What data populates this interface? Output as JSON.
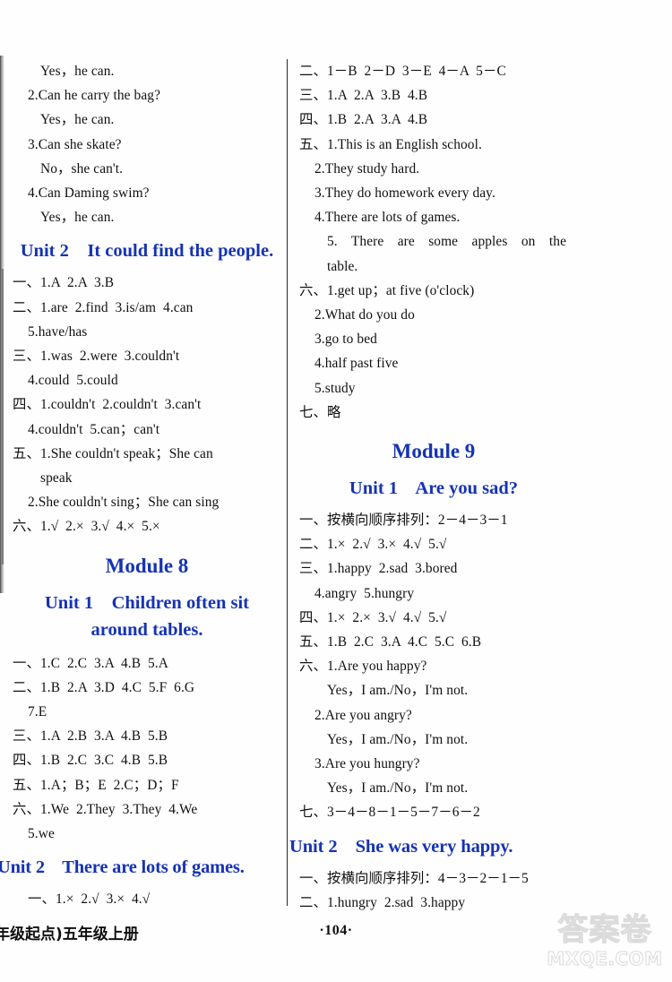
{
  "page": {
    "page_number": "·104·",
    "book_footer": "年级起点)五年级上册",
    "heading_color": "#1633b4"
  },
  "watermark": {
    "chinese": "答案卷",
    "domain": "MXQE.COM"
  },
  "left_column": {
    "blocks": [
      {
        "type": "lines",
        "lines": [
          {
            "indent": 2,
            "text": "Yes，he can."
          },
          {
            "indent": 1,
            "text": "2.Can he carry the bag?"
          },
          {
            "indent": 2,
            "text": "Yes，he can."
          },
          {
            "indent": 1,
            "text": "3.Can she skate?"
          },
          {
            "indent": 2,
            "text": "No，she can't."
          },
          {
            "indent": 1,
            "text": "4.Can Daming swim?"
          },
          {
            "indent": 2,
            "text": "Yes，he can."
          }
        ]
      },
      {
        "type": "unit_heading",
        "unit": "Unit 2",
        "title": "It could find the people.",
        "full": "Unit 2    It could find the people."
      },
      {
        "type": "lines",
        "lines": [
          {
            "indent": 0,
            "text": "一、1.A  2.A  3.B"
          },
          {
            "indent": 0,
            "text": "二、1.are  2.find  3.is/am  4.can"
          },
          {
            "indent": 1,
            "text": "5.have/has"
          },
          {
            "indent": 0,
            "text": "三、1.was  2.were  3.couldn't"
          },
          {
            "indent": 1,
            "text": "4.could  5.could"
          },
          {
            "indent": 0,
            "text": "四、1.couldn't  2.couldn't  3.can't"
          },
          {
            "indent": 1,
            "text": "4.couldn't  5.can；can't"
          },
          {
            "indent": 0,
            "text": "五、1.She couldn't speak；She can"
          },
          {
            "indent": 2,
            "text": "speak"
          },
          {
            "indent": 1,
            "text": "2.She couldn't sing；She can sing"
          },
          {
            "indent": 0,
            "text": "六、1.√  2.×  3.√  4.×  5.×"
          }
        ]
      },
      {
        "type": "module_heading",
        "text": "Module 8"
      },
      {
        "type": "unit_heading_2line",
        "line1": "Unit 1    Children often sit",
        "line2": "around tables."
      },
      {
        "type": "lines",
        "lines": [
          {
            "indent": 0,
            "text": "一、1.C  2.C  3.A  4.B  5.A"
          },
          {
            "indent": 0,
            "text": "二、1.B  2.A  3.D  4.C  5.F  6.G"
          },
          {
            "indent": 1,
            "text": "7.E"
          },
          {
            "indent": 0,
            "text": "三、1.A  2.B  3.A  4.B  5.B"
          },
          {
            "indent": 0,
            "text": "四、1.B  2.C  3.C  4.B  5.B"
          },
          {
            "indent": 0,
            "text": "五、1.A；B；E  2.C；D；F"
          },
          {
            "indent": 0,
            "text": "六、1.We  2.They  3.They  4.We"
          },
          {
            "indent": 1,
            "text": "5.we"
          }
        ]
      },
      {
        "type": "unit_heading_wide",
        "text": "Unit 2    There are lots of games."
      },
      {
        "type": "lines",
        "lines": [
          {
            "indent": 0,
            "text": "一、1.×  2.√  3.×  4.√"
          }
        ]
      }
    ]
  },
  "right_column": {
    "blocks": [
      {
        "type": "lines",
        "lines": [
          {
            "indent": 0,
            "text": "二、1－B  2－D  3－E  4－A  5－C"
          },
          {
            "indent": 0,
            "text": "三、1.A  2.A  3.B  4.B"
          },
          {
            "indent": 0,
            "text": "四、1.B  2.A  3.A  4.B"
          },
          {
            "indent": 0,
            "text": "五、1.This is an English school."
          },
          {
            "indent": 1,
            "text": "2.They study hard."
          },
          {
            "indent": 1,
            "text": "3.They do homework every day."
          },
          {
            "indent": 1,
            "text": "4.There are lots of games."
          }
        ]
      },
      {
        "type": "justified",
        "text": "5. There are some apples on the"
      },
      {
        "type": "lines",
        "lines": [
          {
            "indent": 2,
            "text": "table."
          },
          {
            "indent": 0,
            "text": "六、1.get up；at five (o'clock)"
          },
          {
            "indent": 1,
            "text": "2.What do you do"
          },
          {
            "indent": 1,
            "text": "3.go to bed"
          },
          {
            "indent": 1,
            "text": "4.half past five"
          },
          {
            "indent": 1,
            "text": "5.study"
          },
          {
            "indent": 0,
            "text": "七、略"
          }
        ]
      },
      {
        "type": "module_heading",
        "text": "Module 9"
      },
      {
        "type": "unit_heading",
        "full": "Unit 1    Are you sad?"
      },
      {
        "type": "lines",
        "lines": [
          {
            "indent": 0,
            "text": "一、按横向顺序排列：2－4－3－1"
          },
          {
            "indent": 0,
            "text": "二、1.×  2.√  3.×  4.√  5.√"
          },
          {
            "indent": 0,
            "text": "三、1.happy  2.sad  3.bored"
          },
          {
            "indent": 1,
            "text": "4.angry  5.hungry"
          },
          {
            "indent": 0,
            "text": "四、1.×  2.×  3.√  4.√  5.√"
          },
          {
            "indent": 0,
            "text": "五、1.B  2.C  3.A  4.C  5.C  6.B"
          },
          {
            "indent": 0,
            "text": "六、1.Are you happy?"
          },
          {
            "indent": 2,
            "text": "Yes，I am./No，I'm not."
          },
          {
            "indent": 1,
            "text": "2.Are you angry?"
          },
          {
            "indent": 2,
            "text": "Yes，I am./No，I'm not."
          },
          {
            "indent": 1,
            "text": "3.Are you hungry?"
          },
          {
            "indent": 2,
            "text": "Yes，I am./No，I'm not."
          },
          {
            "indent": 0,
            "text": "七、3－4－8－1－5－7－6－2"
          }
        ]
      },
      {
        "type": "unit_heading_wide",
        "text": "Unit 2    She was very happy."
      },
      {
        "type": "lines",
        "lines": [
          {
            "indent": 0,
            "text": "一、按横向顺序排列：4－3－2－1－5"
          },
          {
            "indent": 0,
            "text": "二、1.hungry  2.sad  3.happy"
          }
        ]
      }
    ]
  }
}
